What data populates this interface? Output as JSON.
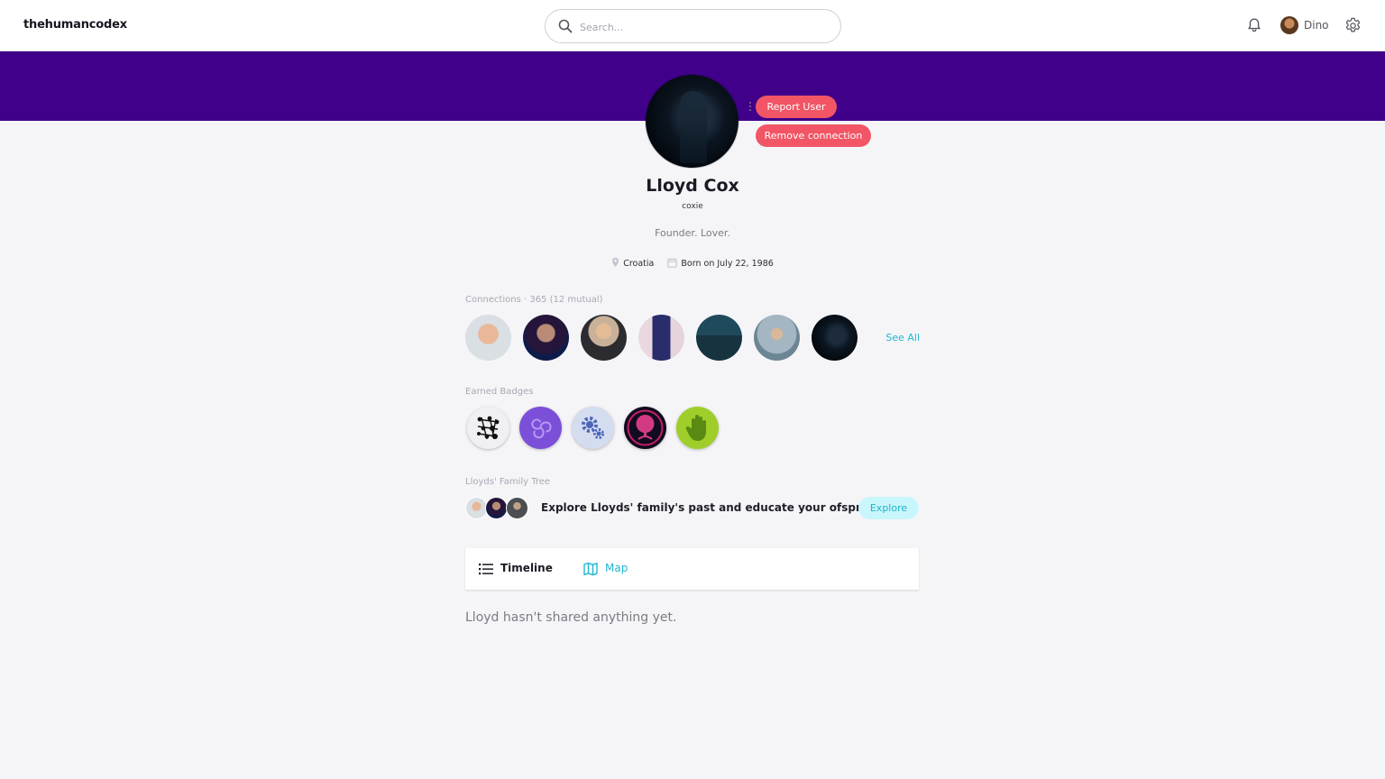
{
  "brand": "thehumancodex",
  "search": {
    "placeholder": "Search..."
  },
  "user": {
    "name": "Dino"
  },
  "profile": {
    "name": "Lloyd Cox",
    "handle": "coxie",
    "bio": "Founder. Lover.",
    "location": "Croatia",
    "birth": "Born on July 22, 1986",
    "report_label": "Report User",
    "remove_label": "Remove connection"
  },
  "connections": {
    "label": "Connections · 365 (12 mutual)",
    "see_all": "See All"
  },
  "badges": {
    "label": "Earned Badges"
  },
  "family_tree": {
    "label": "Lloyds' Family Tree",
    "text": "Explore Lloyds' family's past and educate your ofsprings",
    "button": "Explore"
  },
  "tabs": {
    "timeline": "Timeline",
    "map": "Map"
  },
  "empty_state": "Lloyd hasn't shared anything yet.",
  "colors": {
    "banner": "#40008a",
    "danger": "#f25565",
    "accent": "#21b6d0"
  }
}
